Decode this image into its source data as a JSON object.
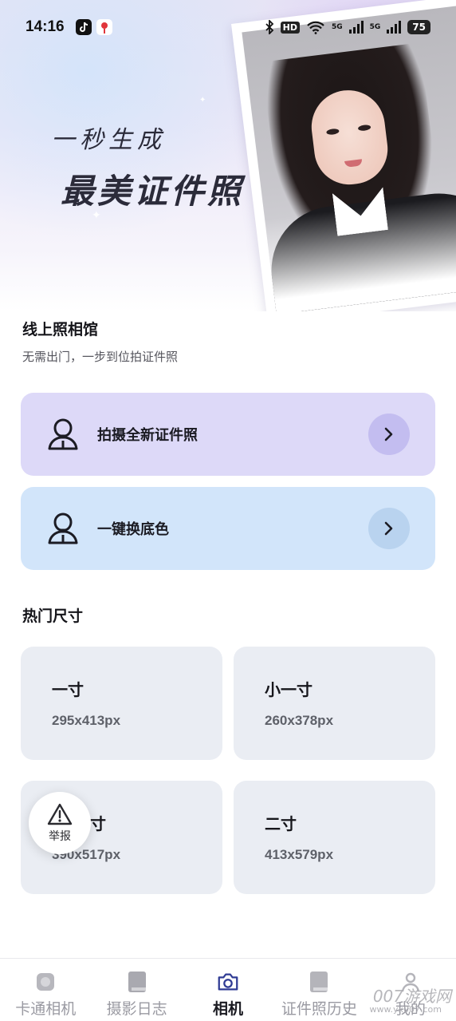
{
  "status_bar": {
    "time": "14:16",
    "hd_label": "HD",
    "network_5g_1": "5G",
    "network_5g_2": "5G",
    "battery": "75"
  },
  "hero": {
    "line1": "一秒生成",
    "line2": "最美证件照"
  },
  "studio": {
    "title": "线上照相馆",
    "subtitle": "无需出门，一步到位拍证件照"
  },
  "actions": [
    {
      "label": "拍摄全新证件照",
      "icon": "person-icon"
    },
    {
      "label": "一键换底色",
      "icon": "person-icon"
    }
  ],
  "popular": {
    "title": "热门尺寸",
    "sizes": [
      {
        "name": "一寸",
        "px": "295x413px"
      },
      {
        "name": "小一寸",
        "px": "260x378px"
      },
      {
        "name": "寸",
        "px": "390x517px"
      },
      {
        "name": "二寸",
        "px": "413x579px"
      }
    ]
  },
  "report": {
    "label": "举报",
    "icon": "warning-icon"
  },
  "tabs": [
    {
      "label": "卡通相机",
      "icon": "cartoon-icon",
      "active": false
    },
    {
      "label": "摄影日志",
      "icon": "book-icon",
      "active": false
    },
    {
      "label": "相机",
      "icon": "camera-icon",
      "active": true
    },
    {
      "label": "证件照历史",
      "icon": "history-book-icon",
      "active": false
    },
    {
      "label": "我的",
      "icon": "user-icon",
      "active": false
    }
  ],
  "watermark": {
    "text": "007游戏网",
    "sub": "www.yx007.com"
  },
  "colors": {
    "accent": "#2f3b94",
    "card_purple": "#ddd9f8",
    "card_blue": "#d2e5fa",
    "size_card": "#eaedf3"
  }
}
